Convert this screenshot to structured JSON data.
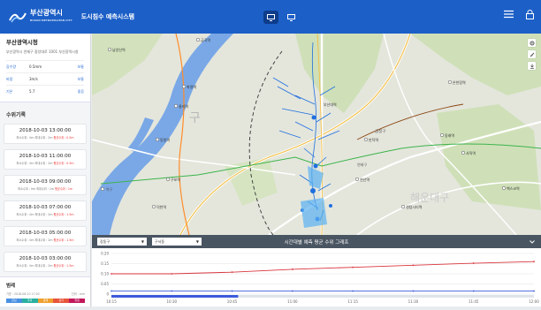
{
  "header": {
    "logo_text": "부산광역시",
    "logo_sub": "BUSAN METROPOLITAN CITY",
    "title": "도시침수 예측시스템",
    "view_btn_1_icon": "monitor-icon",
    "view_btn_2_icon": "monitor-icon",
    "menu_icon": "menu-icon",
    "lock_icon": "lock-icon",
    "colors": {
      "bar": "#1c5fc7"
    }
  },
  "city": {
    "name": "부산광역시청",
    "address": "부산광역시 연제구 중앙대로 1001 부산광역시청",
    "weather": [
      {
        "label": "강수량",
        "value": "0.5mm",
        "status": "보통"
      },
      {
        "label": "바람",
        "value": "3m/s",
        "status": "보통"
      },
      {
        "label": "기온",
        "value": "5.7",
        "status": "좋음"
      }
    ]
  },
  "records": {
    "title": "수위기록",
    "items": [
      {
        "time": "2018-10-03  13:00:00",
        "info_a": "최소수위 : 0m  최대수위 : 2m  ",
        "info_b": "평균수위 : 0.5m"
      },
      {
        "time": "2018-10-03  11:00:00",
        "info_a": "최소수위 : 0m  최대수위 : 2m  ",
        "info_b": "평균수위 : 0.5m"
      },
      {
        "time": "2018-10-03  09:00:00",
        "info_a": "최소수위 : 0m  최대수위 : 1m  ",
        "info_b": "평균수위 : 1m"
      },
      {
        "time": "2018-10-03  07:00:00",
        "info_a": "최소수위 : 0m  최대수위 : 2m  ",
        "info_b": "평균수위 : 1.5m"
      },
      {
        "time": "2018-10-03  05:00:00",
        "info_a": "최소수위 : 0m  최대수위 : 2m  ",
        "info_b": "평균수위 : 1.5m"
      },
      {
        "time": "2018-10-03  03:00:00",
        "info_a": "최소수위 : 0m  최대수위 : 2m  ",
        "info_b": "평균수위 : 1.5m"
      }
    ]
  },
  "legend": {
    "title": "범례",
    "date": "기준 : 2018-08-10  17:00",
    "unit": "단위 : mm",
    "levels": [
      {
        "label": "관심",
        "color": "#4a90e2"
      },
      {
        "label": "주의",
        "color": "#2ab0a0"
      },
      {
        "label": "경계",
        "color": "#f0a030"
      },
      {
        "label": "심각",
        "color": "#e8553a"
      },
      {
        "label": "위험",
        "color": "#c2185b"
      }
    ]
  },
  "map": {
    "labels": [
      {
        "text": "금곡역"
      },
      {
        "text": "남양산역"
      },
      {
        "text": "화명역"
      },
      {
        "text": "율리역"
      },
      {
        "text": "동원역"
      },
      {
        "text": "구포역"
      },
      {
        "text": "덕천역"
      },
      {
        "text": "만덕역"
      },
      {
        "text": "부산대역"
      },
      {
        "text": "온천장역"
      },
      {
        "text": "동래역"
      },
      {
        "text": "사직역"
      },
      {
        "text": "연산역"
      },
      {
        "text": "벡스코역"
      },
      {
        "text": "센텀시티역"
      },
      {
        "text": "금정구"
      },
      {
        "text": "해운대구"
      },
      {
        "text": "북구"
      },
      {
        "text": "연제구"
      }
    ]
  },
  "chart_panel": {
    "district_select": "강동구",
    "area_select": "구서동",
    "title": "시간대별 예측 평균 수위 그래프",
    "collapse_icon": "chevron-down-icon"
  },
  "chart_data": {
    "type": "line",
    "x": [
      "10:15",
      "10:30",
      "10:45",
      "11:00",
      "11:15",
      "11:30",
      "11:45",
      "12:00"
    ],
    "ylim": [
      0,
      0.2
    ],
    "yticks": [
      "0.20",
      "0.15",
      "0.10",
      "0.05",
      "0"
    ],
    "series": [
      {
        "color": "#d9363e",
        "values": [
          0.1,
          0.1,
          0.108,
          0.122,
          0.132,
          0.142,
          0.152,
          0.16
        ]
      },
      {
        "color": "#3b5bdb",
        "values": [
          0.015,
          0.015,
          0.015,
          0.015,
          0.015,
          0.015,
          0.015,
          0.015
        ]
      }
    ],
    "progress_fraction": 0.3
  }
}
